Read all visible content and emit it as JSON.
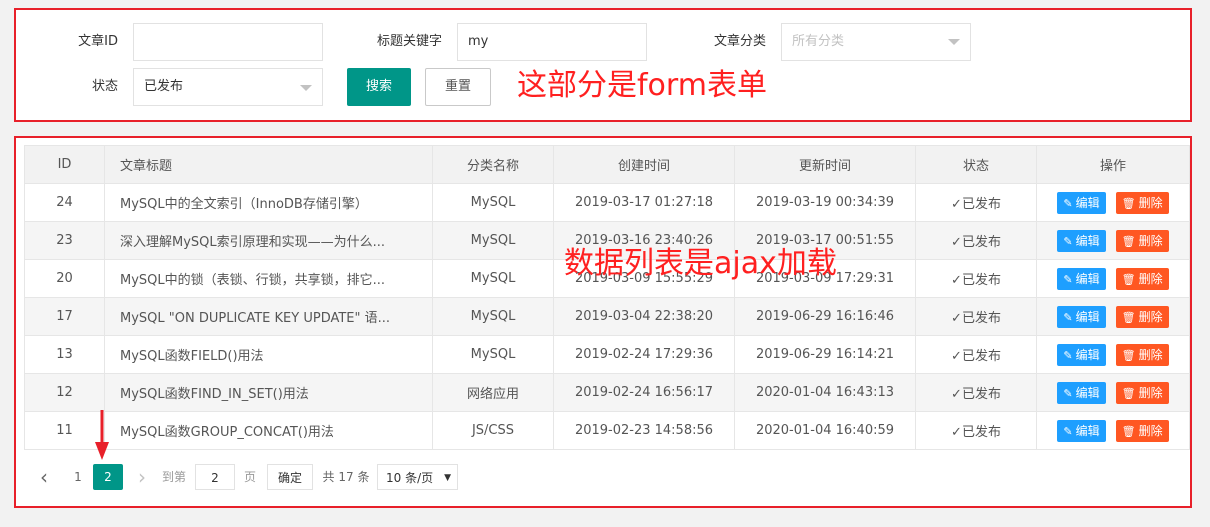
{
  "form": {
    "article_id_label": "文章ID",
    "article_id_value": "",
    "keyword_label": "标题关键字",
    "keyword_value": "my",
    "category_label": "文章分类",
    "category_placeholder": "所有分类",
    "status_label": "状态",
    "status_value": "已发布",
    "search_button": "搜索",
    "reset_button": "重置"
  },
  "annotations": {
    "form": "这部分是form表单",
    "table": "数据列表是ajax加载"
  },
  "table": {
    "columns": [
      "ID",
      "文章标题",
      "分类名称",
      "创建时间",
      "更新时间",
      "状态",
      "操作"
    ],
    "edit_label": "编辑",
    "delete_label": "删除",
    "rows": [
      {
        "id": "24",
        "title": "MySQL中的全文索引（InnoDB存储引擎）",
        "category": "MySQL",
        "created": "2019-03-17 01:27:18",
        "updated": "2019-03-19 00:34:39",
        "status": "✓已发布"
      },
      {
        "id": "23",
        "title": "深入理解MySQL索引原理和实现——为什么...",
        "category": "MySQL",
        "created": "2019-03-16 23:40:26",
        "updated": "2019-03-17 00:51:55",
        "status": "✓已发布"
      },
      {
        "id": "20",
        "title": "MySQL中的锁（表锁、行锁，共享锁，排它...",
        "category": "MySQL",
        "created": "2019-03-09 15:55:29",
        "updated": "2019-03-09 17:29:31",
        "status": "✓已发布"
      },
      {
        "id": "17",
        "title": "MySQL \"ON DUPLICATE KEY UPDATE\" 语...",
        "category": "MySQL",
        "created": "2019-03-04 22:38:20",
        "updated": "2019-06-29 16:16:46",
        "status": "✓已发布"
      },
      {
        "id": "13",
        "title": "MySQL函数FIELD()用法",
        "category": "MySQL",
        "created": "2019-02-24 17:29:36",
        "updated": "2019-06-29 16:14:21",
        "status": "✓已发布"
      },
      {
        "id": "12",
        "title": "MySQL函数FIND_IN_SET()用法",
        "category": "网络应用",
        "created": "2019-02-24 16:56:17",
        "updated": "2020-01-04 16:43:13",
        "status": "✓已发布"
      },
      {
        "id": "11",
        "title": "MySQL函数GROUP_CONCAT()用法",
        "category": "JS/CSS",
        "created": "2019-02-23 14:58:56",
        "updated": "2020-01-04 16:40:59",
        "status": "✓已发布"
      }
    ]
  },
  "pager": {
    "prev": "‹",
    "page_1": "1",
    "page_2": "2",
    "next": "›",
    "goto_label": "到第",
    "goto_value": "2",
    "page_unit": "页",
    "confirm": "确定",
    "total": "共 17 条",
    "page_size": "10 条/页"
  },
  "colors": {
    "accent": "#009688",
    "edit": "#1e9fff",
    "delete": "#ff5722",
    "status": "#5fb878",
    "annotation": "#e8202a"
  }
}
